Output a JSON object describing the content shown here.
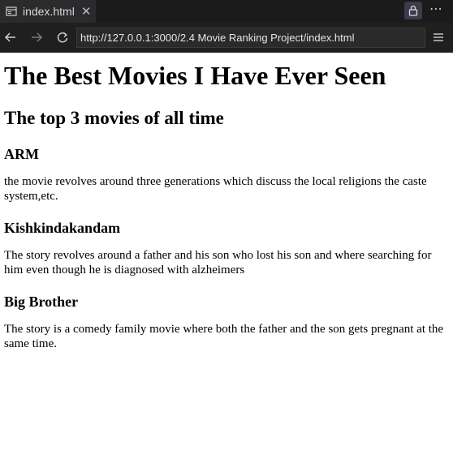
{
  "browser": {
    "tab": {
      "title": "index.html",
      "close_glyph": "✕",
      "icon": "page-icon"
    },
    "more_glyph": "⋯",
    "url": "http://127.0.0.1:3000/2.4 Movie Ranking Project/index.html"
  },
  "page": {
    "heading": "The Best Movies I Have Ever Seen",
    "subheading": "The top 3 movies of all time",
    "movies": [
      {
        "title": "ARM",
        "description": "the movie revolves around three generations which discuss the local religions the caste system,etc."
      },
      {
        "title": "Kishkindakandam",
        "description": "The story revolves around a father and his son who lost his son and where searching for him even though he is diagnosed with alzheimers"
      },
      {
        "title": "Big Brother",
        "description": "The story is a comedy family movie where both the father and the son gets pregnant at the same time."
      }
    ]
  },
  "colors": {
    "chrome_dark": "#1b1b1c",
    "tab_active": "#2b2b2d",
    "page_bg": "#ffffff",
    "text": "#000000"
  }
}
